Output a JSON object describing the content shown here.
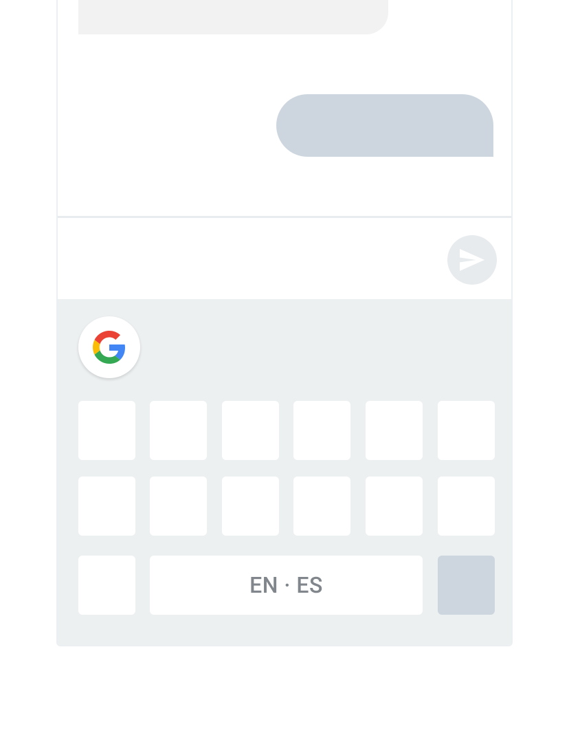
{
  "conversation": {
    "incoming_message": "",
    "outgoing_message": ""
  },
  "compose": {
    "message_text": "",
    "send_icon": "send-icon",
    "send_color": "#e8ebee"
  },
  "keyboard": {
    "google_icon": "google-g-icon",
    "space_label": "EN · ES",
    "background_color": "#edf0f1",
    "enter_key_color": "#cdd6de"
  }
}
